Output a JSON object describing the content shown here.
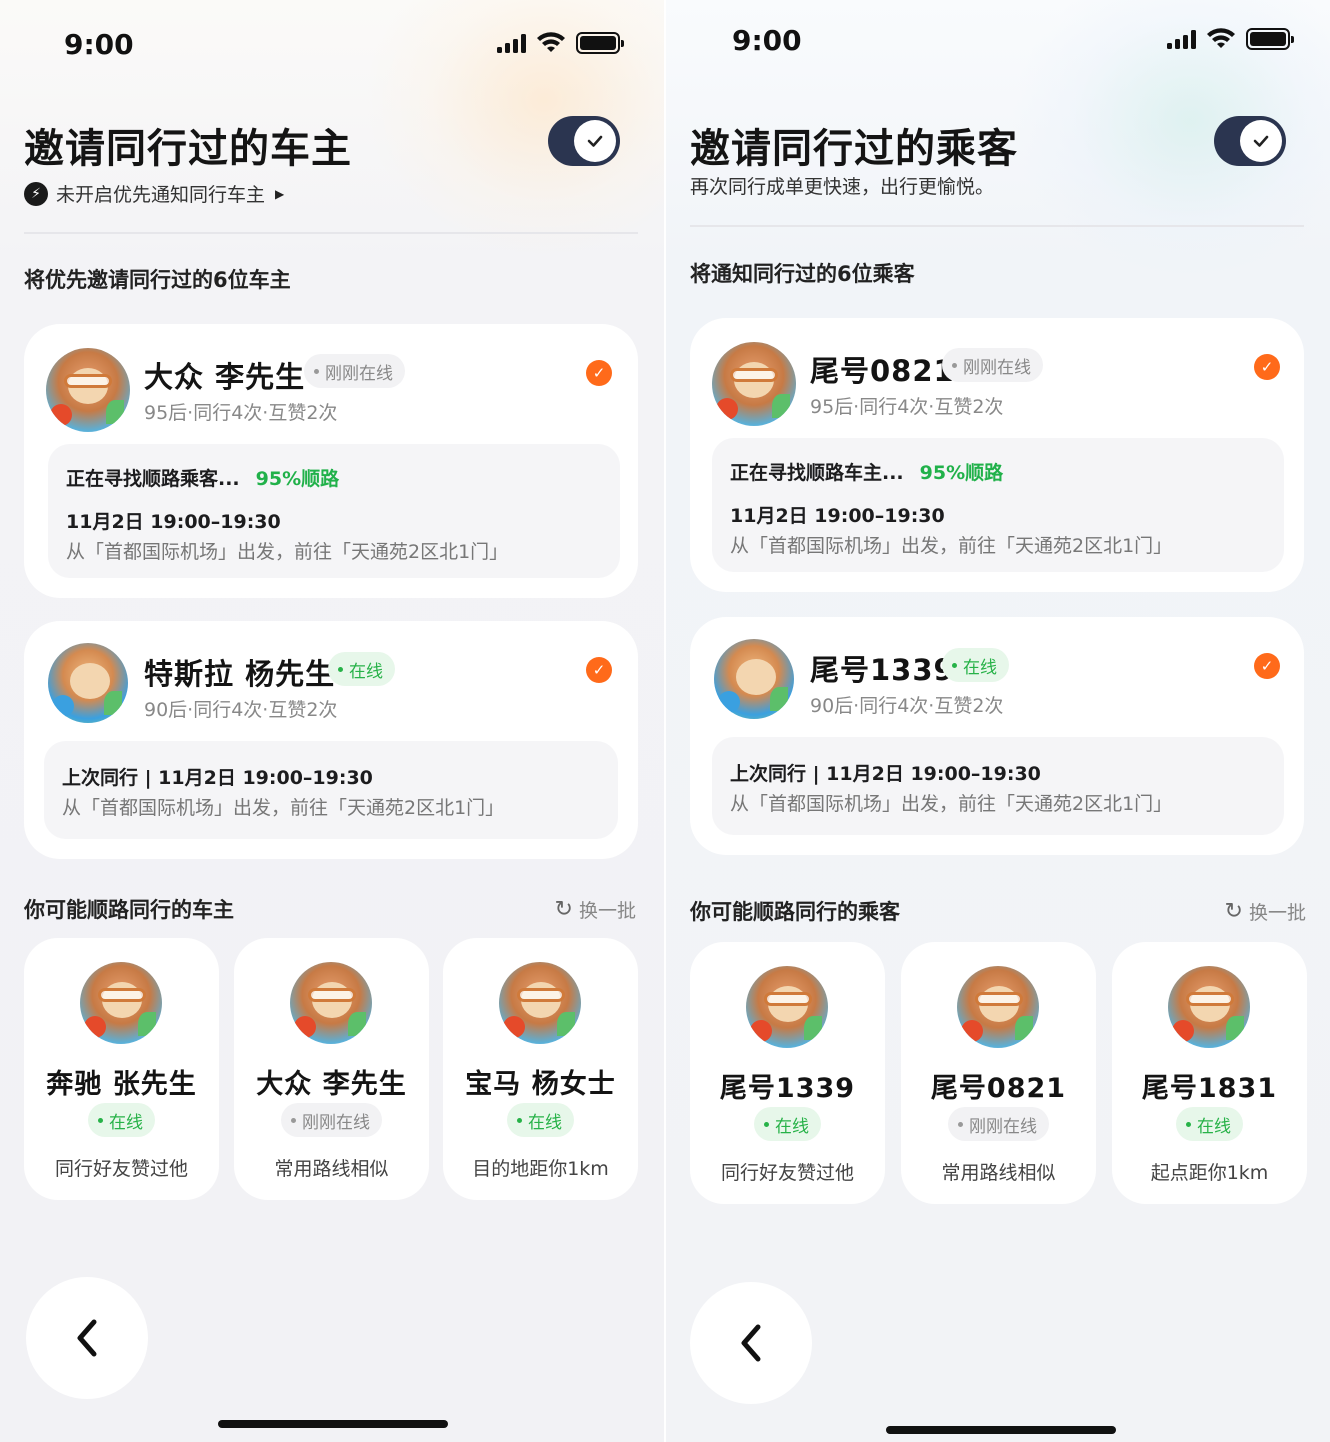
{
  "driver_screen": {
    "status_time": "9:00",
    "title": "邀请同行过的车主",
    "subtitle": "未开启优先通知同行车主",
    "toggle_on": true,
    "section_title": "将优先邀请同行过的6位车主",
    "cards": [
      {
        "name": "大众 李先生",
        "status": "刚刚在线",
        "meta": "95后·同行4次·互赞2次",
        "selected": true,
        "line1": "正在寻找顺路乘客...",
        "percent": "95%顺路",
        "line2": "11月2日   19:00–19:30",
        "line3": "从「首都国际机场」出发，前往「天通苑2区北1门」"
      },
      {
        "name": "特斯拉 杨先生",
        "status": "在线",
        "meta": "90后·同行4次·互赞2次",
        "selected": true,
        "line2": "上次同行 | 11月2日   19:00–19:30",
        "line3": "从「首都国际机场」出发，前往「天通苑2区北1门」"
      }
    ],
    "suggest_title": "你可能顺路同行的车主",
    "refresh_label": "换一批",
    "suggestions": [
      {
        "name": "奔驰 张先生",
        "status": "在线",
        "reason": "同行好友赞过他"
      },
      {
        "name": "大众 李先生",
        "status": "刚刚在线",
        "reason": "常用路线相似"
      },
      {
        "name": "宝马 杨女士",
        "status": "在线",
        "reason": "目的地距你1km"
      }
    ]
  },
  "passenger_screen": {
    "status_time": "9:00",
    "title": "邀请同行过的乘客",
    "subtitle": "再次同行成单更快速，出行更愉悦。",
    "toggle_on": true,
    "section_title": "将通知同行过的6位乘客",
    "cards": [
      {
        "name": "尾号0821",
        "status": "刚刚在线",
        "meta": "95后·同行4次·互赞2次",
        "selected": true,
        "line1": "正在寻找顺路车主...",
        "percent": "95%顺路",
        "line2": "11月2日   19:00–19:30",
        "line3": "从「首都国际机场」出发，前往「天通苑2区北1门」"
      },
      {
        "name": "尾号1339",
        "status": "在线",
        "meta": "90后·同行4次·互赞2次",
        "selected": true,
        "line2": "上次同行 | 11月2日   19:00–19:30",
        "line3": "从「首都国际机场」出发，前往「天通苑2区北1门」"
      }
    ],
    "suggest_title": "你可能顺路同行的乘客",
    "refresh_label": "换一批",
    "suggestions": [
      {
        "name": "尾号1339",
        "status": "在线",
        "reason": "同行好友赞过他"
      },
      {
        "name": "尾号0821",
        "status": "刚刚在线",
        "reason": "常用路线相似"
      },
      {
        "name": "尾号1831",
        "status": "在线",
        "reason": "起点距你1km"
      }
    ]
  },
  "colors": {
    "accent_orange": "#ff6a1a",
    "online_green": "#27b248",
    "toggle_bg": "#2b3550"
  },
  "icons": {
    "back": "chevron-left-icon",
    "refresh": "refresh-icon",
    "check": "check-icon",
    "bolt": "bolt-icon"
  }
}
